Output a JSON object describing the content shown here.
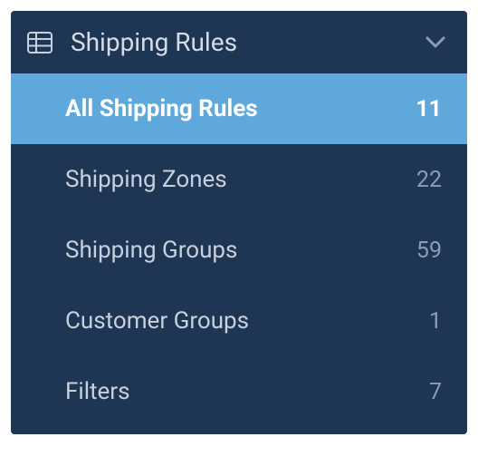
{
  "panel": {
    "title": "Shipping Rules",
    "items": [
      {
        "label": "All Shipping Rules",
        "count": "11",
        "active": true
      },
      {
        "label": "Shipping Zones",
        "count": "22",
        "active": false
      },
      {
        "label": "Shipping Groups",
        "count": "59",
        "active": false
      },
      {
        "label": "Customer Groups",
        "count": "1",
        "active": false
      },
      {
        "label": "Filters",
        "count": "7",
        "active": false
      }
    ]
  }
}
